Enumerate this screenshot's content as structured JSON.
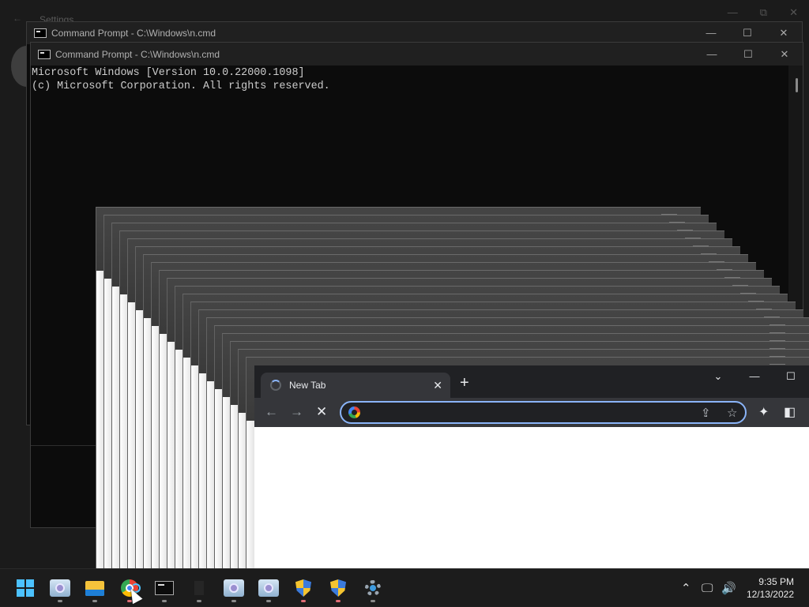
{
  "settings": {
    "title": "Settings",
    "back_icon": "←",
    "minimize": "—",
    "restore": "⧉",
    "close": "✕"
  },
  "cmd_back": {
    "title": "Command Prompt - C:\\Windows\\n.cmd",
    "minimize": "—",
    "maximize": "☐",
    "close": "✕"
  },
  "cmd_front": {
    "title": "Command Prompt - C:\\Windows\\n.cmd",
    "minimize": "—",
    "maximize": "☐",
    "close": "✕",
    "lines": [
      "Microsoft Windows [Version 10.0.22000.1098]",
      "(c) Microsoft Corporation. All rights reserved."
    ]
  },
  "chrome": {
    "tab_title": "New Tab",
    "tab_close": "✕",
    "new_tab": "+",
    "tab_search": "⌄",
    "minimize": "—",
    "maximize": "☐",
    "back": "←",
    "forward": "→",
    "stop": "✕",
    "omnibox_value": "",
    "share": "⇪",
    "star": "☆",
    "extensions": "✦",
    "side_panel": "◧"
  },
  "taskbar": {
    "tray_chevron": "⌃",
    "network": "🖵",
    "volume": "🔊",
    "time": "9:35 PM",
    "date": "12/13/2022",
    "accent": "#4cc2ff"
  }
}
